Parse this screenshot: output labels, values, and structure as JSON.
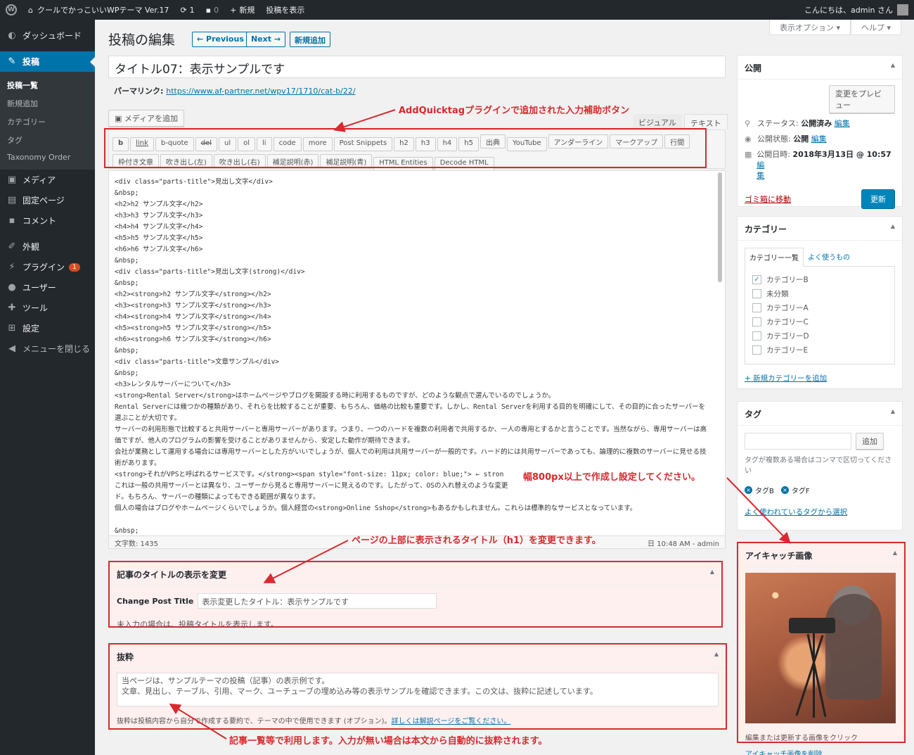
{
  "adminbar": {
    "site_name": "クールでかっこいいWPテーマ Ver.17",
    "updates_count": "1",
    "comments_count": "0",
    "new_label": "新規",
    "view_post_label": "投稿を表示",
    "greeting": "こんにちは、admin さん"
  },
  "sidebar": {
    "items": [
      {
        "icon": "dashboard-icon",
        "label": "ダッシュボード"
      },
      {
        "icon": "pin-icon",
        "label": "投稿"
      },
      {
        "icon": "media-icon",
        "label": "メディア"
      },
      {
        "icon": "page-icon",
        "label": "固定ページ"
      },
      {
        "icon": "comment-icon",
        "label": "コメント"
      },
      {
        "icon": "appearance-icon",
        "label": "外観"
      },
      {
        "icon": "plugin-icon",
        "label": "プラグイン",
        "badge": "1"
      },
      {
        "icon": "user-icon",
        "label": "ユーザー"
      },
      {
        "icon": "tools-icon",
        "label": "ツール"
      },
      {
        "icon": "settings-icon",
        "label": "設定"
      },
      {
        "icon": "collapse-icon",
        "label": "メニューを閉じる"
      }
    ],
    "submenu": [
      "投稿一覧",
      "新規追加",
      "カテゴリー",
      "タグ",
      "Taxonomy Order"
    ]
  },
  "header": {
    "screen_options": "表示オプション ▾",
    "help": "ヘルプ ▾",
    "title": "投稿の編集",
    "previous": "← Previous",
    "next": "Next →",
    "add_new": "新規追加"
  },
  "post": {
    "title": "タイトル07：表示サンプルです",
    "permalink_label": "パーマリンク:",
    "permalink_url": "https://www.af-partner.net/wpv17/1710/cat-b/22/"
  },
  "editor": {
    "media_button": "メディアを追加",
    "tab_visual": "ビジュアル",
    "tab_text": "テキスト",
    "quicktags_row1": [
      "b",
      "link",
      "b-quote",
      "del",
      "ul",
      "ol",
      "li",
      "code",
      "more",
      "Post Snippets",
      "h2",
      "h3",
      "h4",
      "h5",
      "出典",
      "YouTube",
      "アンダーライン",
      "マークアップ",
      "行間"
    ],
    "quicktags_row2": [
      "枠付き文章",
      "吹き出し(左)",
      "吹き出し(右)",
      "補足説明(赤)",
      "補足説明(青)",
      "HTML Entities",
      "Decode HTML"
    ],
    "lines": [
      "<div class=\"parts-title\">見出し文字</div>",
      "&nbsp;",
      "<h2>h2 サンプル文字</h2>",
      "<h3>h3 サンプル文字</h3>",
      "<h4>h4 サンプル文字</h4>",
      "<h5>h5 サンプル文字</h5>",
      "<h6>h6 サンプル文字</h6>",
      "&nbsp;",
      "<div class=\"parts-title\">見出し文字(strong)</div>",
      "&nbsp;",
      "<h2><strong>h2 サンプル文字</strong></h2>",
      "<h3><strong>h3 サンプル文字</strong></h3>",
      "<h4><strong>h4 サンプル文字</strong></h4>",
      "<h5><strong>h5 サンプル文字</strong></h5>",
      "<h6><strong>h6 サンプル文字</strong></h6>",
      "&nbsp;",
      "<div class=\"parts-title\">文章サンプル</div>",
      "&nbsp;",
      "<h3>レンタルサーバーについて</h3>",
      "<strong>Rental Server</strong>はホームページやブログを開設する時に利用するものですが、どのような観点で選んでいるのでしょうか。",
      "Rental Serverには幾つかの種類があり、それらを比較することが重要、もちろん、価格の比較も重要です。しかし、Rental Serverを利用する目的を明確にして、その目的に合ったサーバーを選ぶことが大切です。",
      "サーバーの利用形態で比較すると共用サーバーと専用サーバーがあります。つまり、一つのハードを複数の利用者で共用するか、一人の専用とするかと言うことです。当然ながら、専用サーバーは高価ですが、他人のプログラムの影響を受けることがありませんから、安定した動作が期待できます。",
      "会社が業務として運用する場合には専用サーバーとした方がいいでしょうが、個人での利用は共用サーバーが一般的です。ハード的には共用サーバーであっても、論理的に複数のサーバーに見せる技術があります。",
      "<strong>それがVPSと呼ばれるサービスです。</strong><span style=\"font-size: 11px; color: blue;\"> ← stron",
      "これは一般の共用サーバーとは異なり、ユーザーから見ると専用サーバーに見えるのです。したがって、OSの入れ替えのような変更",
      "ド。もちろん、サーバーの種類によってもできる範囲が異なります。",
      "個人の場合はブログやホームページくらいでしょうか。個人経営の<strong>Online Sshop</strong>もあるかもしれません。これらは標準的なサービスとなっています。",
      "",
      "&nbsp;"
    ],
    "word_count": "文字数: 1435",
    "last_edit": "日 10:48 AM - admin"
  },
  "change_title_box": {
    "title": "記事のタイトルの表示を変更",
    "field_label": "Change Post Title",
    "field_value": "表示変更したタイトル：表示サンプルです",
    "note": "未入力の場合は、投稿タイトルを表示します。"
  },
  "excerpt_box": {
    "title": "抜粋",
    "text_line1": "当ページは、サンプルテーマの投稿（記事）の表示例です。",
    "text_line2": "文章、見出し、テーブル、引用、マーク、ユーチューブの埋め込み等の表示サンプルを確認できます。この文は、抜粋に記述しています。",
    "note": "抜粋は投稿内容から自分で作成する要約で、テーマの中で使用できます (オプション)。",
    "note_link": "詳しくは解説ページをご覧ください。"
  },
  "publish_box": {
    "title": "公開",
    "preview_button": "変更をプレビュー",
    "status_label": "ステータス:",
    "status_value": "公開済み",
    "visibility_label": "公開状態:",
    "visibility_value": "公開",
    "date_label": "公開日時:",
    "date_value": "2018年3月13日 @ 10:57",
    "edit": "編集",
    "edit_split_a": "編",
    "edit_split_b": "集",
    "trash": "ゴミ箱に移動",
    "update_button": "更新"
  },
  "category_box": {
    "title": "カテゴリー",
    "tab_all": "カテゴリー一覧",
    "tab_popular": "よく使うもの",
    "items": [
      {
        "label": "カテゴリーB",
        "checked": true
      },
      {
        "label": "未分類",
        "checked": false
      },
      {
        "label": "カテゴリーA",
        "checked": false
      },
      {
        "label": "カテゴリーC",
        "checked": false
      },
      {
        "label": "カテゴリーD",
        "checked": false
      },
      {
        "label": "カテゴリーE",
        "checked": false
      }
    ],
    "add_new": "+ 新規カテゴリーを追加"
  },
  "tag_box": {
    "title": "タグ",
    "add_button": "追加",
    "help": "タグが複数ある場合はコンマで区切ってください",
    "tags": [
      "タグB",
      "タグF"
    ],
    "choose_link": "よく使われているタグから選択"
  },
  "eyecatch_box": {
    "title": "アイキャッチ画像",
    "note": "編集または更新する画像をクリック",
    "remove": "アイキャッチ画像を削除"
  },
  "annotations": {
    "quicktag": "AddQuicktagプラグインで追加された入力補助ボタン",
    "title_change": "ページの上部に表示されるタイトル（h1）を変更できます。",
    "width": "幅800px以上で作成し設定してください。",
    "excerpt": "記事一覧等で利用します。入力が無い場合は本文から自動的に抜粋されます。"
  },
  "colors": {
    "annotation_red": "#d9292e",
    "wp_blue": "#0073aa",
    "adminbar_bg": "#23282d"
  }
}
